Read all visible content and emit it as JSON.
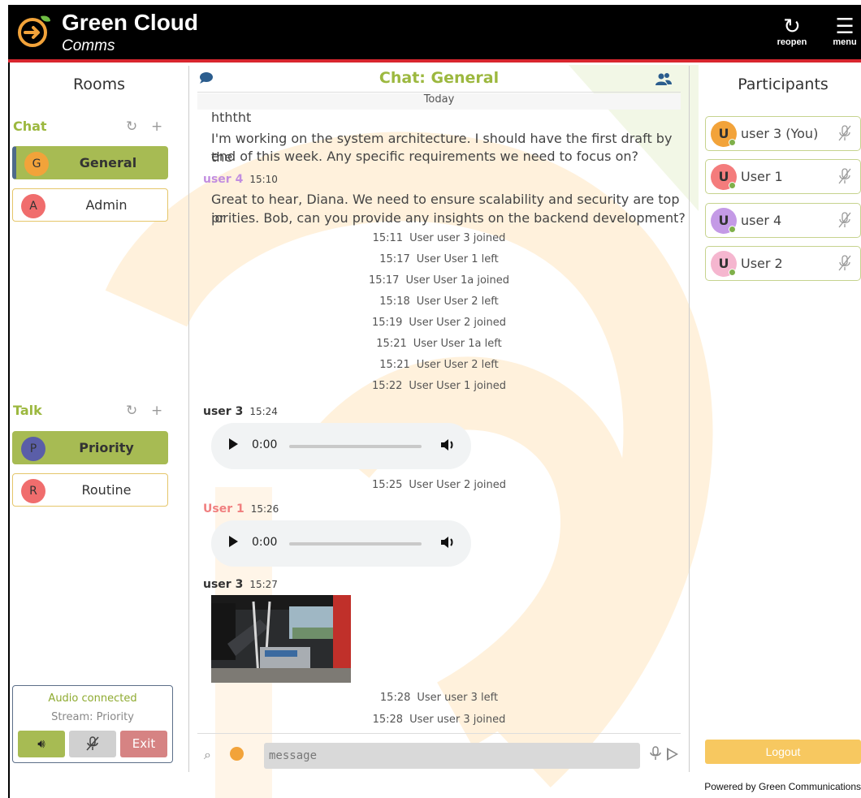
{
  "colors": {
    "brand_green": "#9cb83f",
    "accent_red": "#d8262e",
    "room_active": "#a7bb53",
    "logout": "#f7c860"
  },
  "header": {
    "title": "Green Cloud",
    "subtitle": "Comms",
    "reopen_label": "reopen",
    "menu_label": "menu",
    "reopen_icon": "refresh-icon",
    "menu_icon": "hamburger-icon"
  },
  "rooms": {
    "title": "Rooms",
    "chat_section": {
      "label": "Chat",
      "items": [
        {
          "initial": "G",
          "name": "General",
          "avatar_color": "#f2a33a",
          "active": true
        },
        {
          "initial": "A",
          "name": "Admin",
          "avatar_color": "#f06d6d",
          "active": false
        }
      ]
    },
    "talk_section": {
      "label": "Talk",
      "items": [
        {
          "initial": "P",
          "name": "Priority",
          "avatar_color": "#5a5ea8",
          "active": true
        },
        {
          "initial": "R",
          "name": "Routine",
          "avatar_color": "#f06d6d",
          "active": false
        }
      ]
    },
    "audio": {
      "status": "Audio connected",
      "stream": "Stream: Priority",
      "exit_label": "Exit"
    }
  },
  "chat": {
    "title": "Chat: General",
    "day_label": "Today",
    "partial_line": "hththt",
    "msg1_line1": "I'm working on the system architecture. I should have the first draft by the",
    "msg1_line2": "end of this week. Any specific requirements we need to focus on?",
    "msg2": {
      "author": "user 4",
      "time": "15:10",
      "color": "#c28ee0",
      "line1": "Great to hear, Diana. We need to ensure scalability and security are top pr",
      "line2": "iorities. Bob, can you provide any insights on the backend development?"
    },
    "system": [
      {
        "time": "15:11",
        "text": "User user 3 joined"
      },
      {
        "time": "15:17",
        "text": "User User 1 left"
      },
      {
        "time": "15:17",
        "text": "User User 1a joined"
      },
      {
        "time": "15:18",
        "text": "User User 2 left"
      },
      {
        "time": "15:19",
        "text": "User User 2 joined"
      },
      {
        "time": "15:21",
        "text": "User User 1a left"
      },
      {
        "time": "15:21",
        "text": "User User 2 left"
      },
      {
        "time": "15:22",
        "text": "User User 1 joined"
      }
    ],
    "audio_msg1": {
      "author": "user 3",
      "time": "15:24",
      "color": "#333333",
      "player_time": "0:00"
    },
    "sys_after_audio1": {
      "time": "15:25",
      "text": "User User 2 joined"
    },
    "audio_msg2": {
      "author": "User 1",
      "time": "15:26",
      "color": "#f07f7f",
      "player_time": "0:00"
    },
    "image_msg": {
      "author": "user 3",
      "time": "15:27",
      "color": "#333333"
    },
    "system_end": [
      {
        "time": "15:28",
        "text": "User user 3 left"
      },
      {
        "time": "15:28",
        "text": "User user 3 joined"
      }
    ],
    "composer": {
      "placeholder": "message"
    }
  },
  "participants": {
    "title": "Participants",
    "items": [
      {
        "initial": "U",
        "name": "user 3 (You)",
        "avatar_color": "#f2a33a"
      },
      {
        "initial": "U",
        "name": "User 1",
        "avatar_color": "#f47c7c"
      },
      {
        "initial": "U",
        "name": "user 4",
        "avatar_color": "#c49ae6"
      },
      {
        "initial": "U",
        "name": "User 2",
        "avatar_color": "#f5b6cf"
      }
    ],
    "logout_label": "Logout"
  },
  "footer": {
    "text": "Powered by Green Communications"
  }
}
